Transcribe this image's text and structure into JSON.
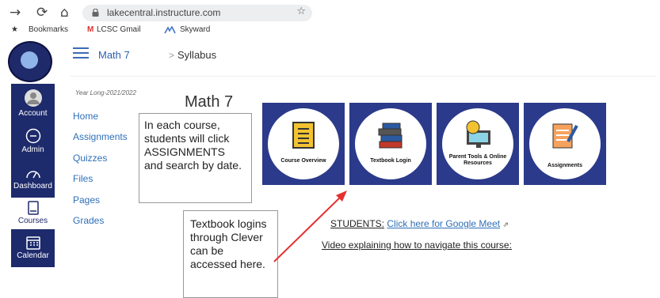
{
  "browser": {
    "url": "lakecentral.instructure.com",
    "bookmarks": [
      "Bookmarks",
      "LCSC Gmail",
      "Skyward"
    ]
  },
  "global_nav": {
    "items": [
      "Account",
      "Admin",
      "Dashboard",
      "Courses",
      "Calendar"
    ],
    "accent": "#1d2a6b"
  },
  "breadcrumb": {
    "course": "Math 7",
    "separator": ">",
    "page": "Syllabus"
  },
  "course_nav": {
    "term": "Year Long-2021/2022",
    "items": [
      "Home",
      "Assignments",
      "Quizzes",
      "Files",
      "Pages",
      "Grades"
    ]
  },
  "main": {
    "title": "Math 7",
    "tiles": [
      {
        "label": "Course Overview",
        "icon": "document-icon"
      },
      {
        "label": "Textbook Login",
        "icon": "books-icon"
      },
      {
        "label": "Parent Tools & Online Resources",
        "icon": "lightbulb-monitor-icon"
      },
      {
        "label": "Assignments",
        "icon": "notepad-icon"
      }
    ],
    "tile_color": "#2b3a8a",
    "students_label": "STUDENTS:",
    "meet_link": "Click here for Google Meet",
    "video_link": "Video explaining how to navigate this course:"
  },
  "callouts": {
    "assignments_note": "In each course, students will click ASSIGNMENTS and search by date.",
    "textbook_note": "Textbook logins through Clever can be accessed here."
  }
}
